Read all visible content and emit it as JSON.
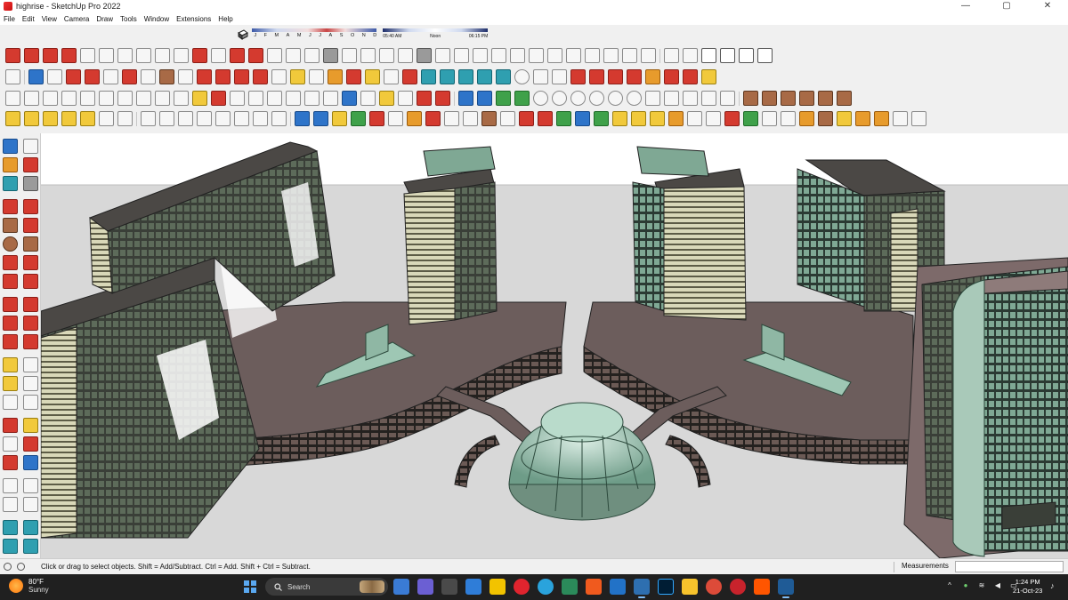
{
  "window": {
    "title": "highrise - SketchUp Pro 2022",
    "minimize": "—",
    "maximize": "▢",
    "close": "✕"
  },
  "menu": [
    "File",
    "Edit",
    "View",
    "Camera",
    "Draw",
    "Tools",
    "Window",
    "Extensions",
    "Help"
  ],
  "shadows": {
    "months": [
      "J",
      "F",
      "M",
      "A",
      "M",
      "J",
      "J",
      "A",
      "S",
      "O",
      "N",
      "D"
    ],
    "time_start": "05:40 AM",
    "time_mid": "Noon",
    "time_end": "06:15 PM"
  },
  "status": {
    "message": "Click or drag to select objects. Shift = Add/Subtract. Ctrl = Add. Shift + Ctrl = Subtract.",
    "measurements_label": "Measurements",
    "measurements_value": ""
  },
  "taskbar": {
    "weather_temp": "80°F",
    "weather_desc": "Sunny",
    "search_placeholder": "Search",
    "time": "1:24 PM",
    "date": "21-Oct-23",
    "apps": [
      "file-explorer",
      "chat",
      "task-view",
      "calendar",
      "notes",
      "opera",
      "telegram",
      "word-app",
      "brave",
      "vscode",
      "sketchup-badge",
      "photoshop",
      "drive",
      "chrome",
      "pinterest",
      "soundcloud",
      "sketchup"
    ]
  },
  "colors": {
    "brand_red": "#d43a2f",
    "viewport_ground": "#d8d8d8",
    "taskbar": "#202020"
  }
}
